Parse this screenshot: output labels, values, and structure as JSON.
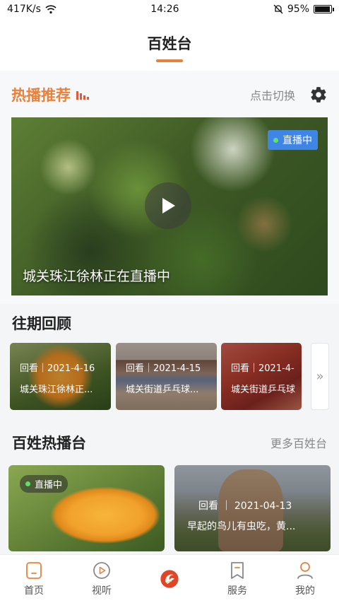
{
  "status_bar": {
    "net_speed": "417K/s",
    "time": "14:26",
    "battery": "95%",
    "battery_level": 0.95
  },
  "header": {
    "title": "百姓台"
  },
  "hot": {
    "title": "热播推荐",
    "switch_label": "点击切换",
    "hero": {
      "badge": "直播中",
      "caption": "城关珠江徐林正在直播中"
    }
  },
  "past": {
    "title": "往期回顾",
    "items": [
      {
        "date": "回看｜2021-4-16",
        "name": "城关珠江徐林正..."
      },
      {
        "date": "回看｜2021-4-15",
        "name": "城关街道乒乓球..."
      },
      {
        "date": "回看｜2021-4-",
        "name": "城关街道乒乓球"
      }
    ],
    "more_icon": "»"
  },
  "baixing": {
    "title": "百姓热播台",
    "more_label": "更多百姓台",
    "cards": [
      {
        "badge": "直播中"
      },
      {
        "date": "回看 ｜ 2021-04-13",
        "text": "早起的鸟儿有虫吃，黄..."
      }
    ]
  },
  "bottom_nav": {
    "items": [
      {
        "label": "首页",
        "icon": "home-icon"
      },
      {
        "label": "视听",
        "icon": "play-circle-icon"
      },
      {
        "label": "",
        "icon": "phoenix-logo-icon"
      },
      {
        "label": "服务",
        "icon": "bookmark-icon"
      },
      {
        "label": "我的",
        "icon": "user-icon"
      }
    ]
  },
  "colors": {
    "accent": "#e8823a",
    "live_badge": "#3f85e6",
    "live_dot": "#5ee06a"
  }
}
